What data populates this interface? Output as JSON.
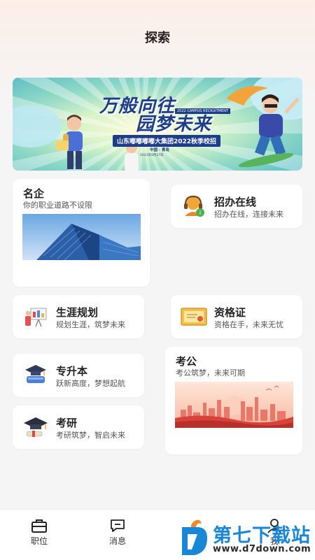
{
  "header": {
    "title": "探索"
  },
  "banner": {
    "headline_1": "万般向往",
    "headline_2": "园梦未来",
    "tag": "2022 CAMPUS RECRUITMENT",
    "subtitle": "山东嘟嘟嘟嘟大集团2022秋季校招",
    "location": "中国 · 青岛",
    "date": "2021年9月27日"
  },
  "cards": {
    "mingqi": {
      "title": "名企",
      "subtitle": "你的职业道路不设限"
    },
    "zhaoban": {
      "title": "招办在线",
      "subtitle": "招办在线，连接未来"
    },
    "shengya": {
      "title": "生涯规划",
      "subtitle": "规划生涯，筑梦未来"
    },
    "zige": {
      "title": "资格证",
      "subtitle": "资格在手，未来无忧"
    },
    "zhuanshengben": {
      "title": "专升本",
      "subtitle": "跃新高度，梦想起航"
    },
    "kaogong": {
      "title": "考公",
      "subtitle": "考公筑梦，未来可期"
    },
    "kaoyan": {
      "title": "考研",
      "subtitle": "考研筑梦，智启未来"
    }
  },
  "bottom_nav": {
    "items": [
      {
        "label": "职位",
        "icon": "briefcase-icon"
      },
      {
        "label": "消息",
        "icon": "message-icon"
      },
      {
        "label": "",
        "icon": "explore-icon"
      },
      {
        "label": "我",
        "icon": "user-icon"
      }
    ]
  },
  "watermark": {
    "name": "第七下载站",
    "url": "www.d7down.com"
  },
  "colors": {
    "accent": "#1d3c8c",
    "watermark": "#1a86d8",
    "background": "#f5f5f6"
  }
}
